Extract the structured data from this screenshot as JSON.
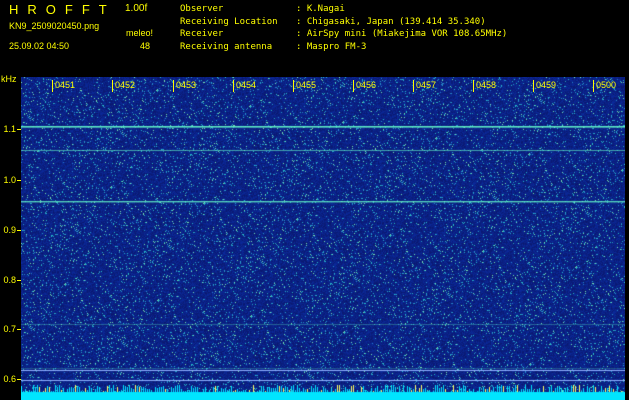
{
  "header": {
    "app_name": "HROFFT",
    "version": "1.00f",
    "filename": "KN9_2509020450.png",
    "program": "meleo!",
    "datetime": "25.09.02 04:50",
    "count": "48"
  },
  "info": [
    {
      "label": "Observer",
      "value": ": K.Nagai"
    },
    {
      "label": "Receiving Location",
      "value": ": Chigasaki, Japan (139.414 35.340)"
    },
    {
      "label": "Receiver",
      "value": ": AirSpy mini (Miakejima VOR 108.65MHz)"
    },
    {
      "label": "Receiving antenna",
      "value": ": Maspro FM-3"
    }
  ],
  "axis": {
    "unit": "kHz",
    "y_ticks": [
      "1.1",
      "1.0",
      "0.9",
      "0.8",
      "0.7",
      "0.6"
    ],
    "x_ticks": [
      "0451",
      "0452",
      "0453",
      "0454",
      "0455",
      "0456",
      "0457",
      "0458",
      "0459",
      "0500"
    ]
  },
  "colors": {
    "label": "#ffff00",
    "background": "#000000",
    "plot_base": "#0a1a7a",
    "trace": "#66ffcc",
    "floor": "#00e5ff"
  }
}
